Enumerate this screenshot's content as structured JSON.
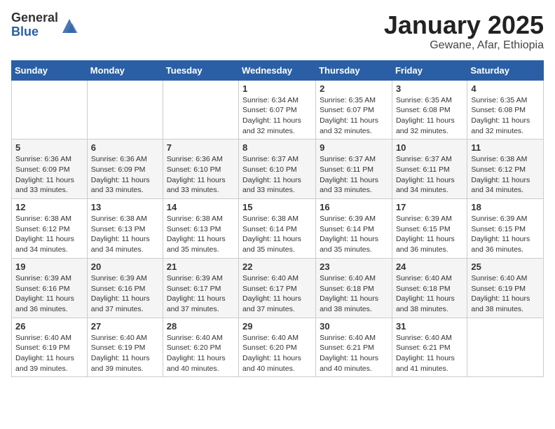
{
  "logo": {
    "general": "General",
    "blue": "Blue"
  },
  "header": {
    "month": "January 2025",
    "location": "Gewane, Afar, Ethiopia"
  },
  "days_of_week": [
    "Sunday",
    "Monday",
    "Tuesday",
    "Wednesday",
    "Thursday",
    "Friday",
    "Saturday"
  ],
  "weeks": [
    [
      {
        "day": "",
        "info": ""
      },
      {
        "day": "",
        "info": ""
      },
      {
        "day": "",
        "info": ""
      },
      {
        "day": "1",
        "info": "Sunrise: 6:34 AM\nSunset: 6:07 PM\nDaylight: 11 hours and 32 minutes."
      },
      {
        "day": "2",
        "info": "Sunrise: 6:35 AM\nSunset: 6:07 PM\nDaylight: 11 hours and 32 minutes."
      },
      {
        "day": "3",
        "info": "Sunrise: 6:35 AM\nSunset: 6:08 PM\nDaylight: 11 hours and 32 minutes."
      },
      {
        "day": "4",
        "info": "Sunrise: 6:35 AM\nSunset: 6:08 PM\nDaylight: 11 hours and 32 minutes."
      }
    ],
    [
      {
        "day": "5",
        "info": "Sunrise: 6:36 AM\nSunset: 6:09 PM\nDaylight: 11 hours and 33 minutes."
      },
      {
        "day": "6",
        "info": "Sunrise: 6:36 AM\nSunset: 6:09 PM\nDaylight: 11 hours and 33 minutes."
      },
      {
        "day": "7",
        "info": "Sunrise: 6:36 AM\nSunset: 6:10 PM\nDaylight: 11 hours and 33 minutes."
      },
      {
        "day": "8",
        "info": "Sunrise: 6:37 AM\nSunset: 6:10 PM\nDaylight: 11 hours and 33 minutes."
      },
      {
        "day": "9",
        "info": "Sunrise: 6:37 AM\nSunset: 6:11 PM\nDaylight: 11 hours and 33 minutes."
      },
      {
        "day": "10",
        "info": "Sunrise: 6:37 AM\nSunset: 6:11 PM\nDaylight: 11 hours and 34 minutes."
      },
      {
        "day": "11",
        "info": "Sunrise: 6:38 AM\nSunset: 6:12 PM\nDaylight: 11 hours and 34 minutes."
      }
    ],
    [
      {
        "day": "12",
        "info": "Sunrise: 6:38 AM\nSunset: 6:12 PM\nDaylight: 11 hours and 34 minutes."
      },
      {
        "day": "13",
        "info": "Sunrise: 6:38 AM\nSunset: 6:13 PM\nDaylight: 11 hours and 34 minutes."
      },
      {
        "day": "14",
        "info": "Sunrise: 6:38 AM\nSunset: 6:13 PM\nDaylight: 11 hours and 35 minutes."
      },
      {
        "day": "15",
        "info": "Sunrise: 6:38 AM\nSunset: 6:14 PM\nDaylight: 11 hours and 35 minutes."
      },
      {
        "day": "16",
        "info": "Sunrise: 6:39 AM\nSunset: 6:14 PM\nDaylight: 11 hours and 35 minutes."
      },
      {
        "day": "17",
        "info": "Sunrise: 6:39 AM\nSunset: 6:15 PM\nDaylight: 11 hours and 36 minutes."
      },
      {
        "day": "18",
        "info": "Sunrise: 6:39 AM\nSunset: 6:15 PM\nDaylight: 11 hours and 36 minutes."
      }
    ],
    [
      {
        "day": "19",
        "info": "Sunrise: 6:39 AM\nSunset: 6:16 PM\nDaylight: 11 hours and 36 minutes."
      },
      {
        "day": "20",
        "info": "Sunrise: 6:39 AM\nSunset: 6:16 PM\nDaylight: 11 hours and 37 minutes."
      },
      {
        "day": "21",
        "info": "Sunrise: 6:39 AM\nSunset: 6:17 PM\nDaylight: 11 hours and 37 minutes."
      },
      {
        "day": "22",
        "info": "Sunrise: 6:40 AM\nSunset: 6:17 PM\nDaylight: 11 hours and 37 minutes."
      },
      {
        "day": "23",
        "info": "Sunrise: 6:40 AM\nSunset: 6:18 PM\nDaylight: 11 hours and 38 minutes."
      },
      {
        "day": "24",
        "info": "Sunrise: 6:40 AM\nSunset: 6:18 PM\nDaylight: 11 hours and 38 minutes."
      },
      {
        "day": "25",
        "info": "Sunrise: 6:40 AM\nSunset: 6:19 PM\nDaylight: 11 hours and 38 minutes."
      }
    ],
    [
      {
        "day": "26",
        "info": "Sunrise: 6:40 AM\nSunset: 6:19 PM\nDaylight: 11 hours and 39 minutes."
      },
      {
        "day": "27",
        "info": "Sunrise: 6:40 AM\nSunset: 6:19 PM\nDaylight: 11 hours and 39 minutes."
      },
      {
        "day": "28",
        "info": "Sunrise: 6:40 AM\nSunset: 6:20 PM\nDaylight: 11 hours and 40 minutes."
      },
      {
        "day": "29",
        "info": "Sunrise: 6:40 AM\nSunset: 6:20 PM\nDaylight: 11 hours and 40 minutes."
      },
      {
        "day": "30",
        "info": "Sunrise: 6:40 AM\nSunset: 6:21 PM\nDaylight: 11 hours and 40 minutes."
      },
      {
        "day": "31",
        "info": "Sunrise: 6:40 AM\nSunset: 6:21 PM\nDaylight: 11 hours and 41 minutes."
      },
      {
        "day": "",
        "info": ""
      }
    ]
  ]
}
